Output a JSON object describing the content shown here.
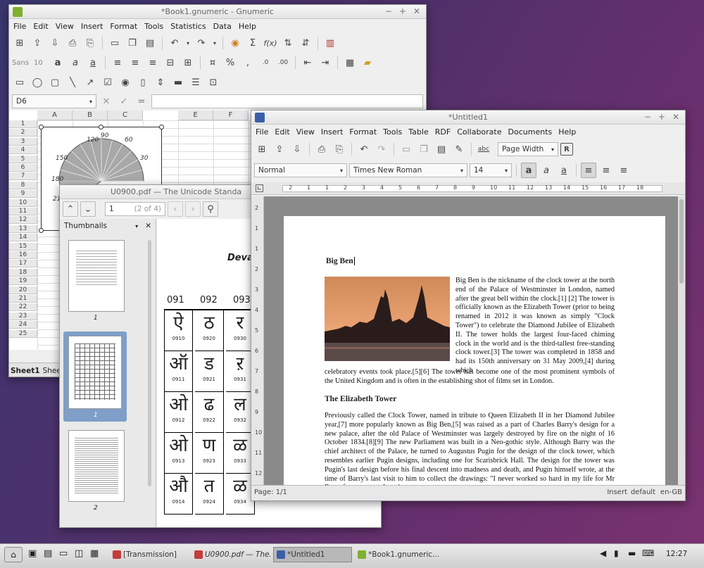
{
  "gnumeric": {
    "title": "*Book1.gnumeric - Gnumeric",
    "menu": [
      "File",
      "Edit",
      "View",
      "Insert",
      "Format",
      "Tools",
      "Statistics",
      "Data",
      "Help"
    ],
    "font_name": "Sans",
    "font_size": "10",
    "cell_ref": "D6",
    "columns": [
      "A",
      "B",
      "C",
      "E",
      "F"
    ],
    "rows": [
      "1",
      "2",
      "3",
      "4",
      "5",
      "6",
      "7",
      "8",
      "9",
      "10",
      "11",
      "12",
      "13",
      "14",
      "15",
      "16",
      "17",
      "18",
      "19",
      "20",
      "21",
      "22",
      "23",
      "24",
      "25"
    ],
    "dial_labels": [
      "120",
      "90",
      "60",
      "150",
      "30",
      "180",
      "210"
    ],
    "sheet_tabs": [
      "Sheet1",
      "Shee"
    ]
  },
  "pdf": {
    "title": "U0900.pdf — The Unicode Standa",
    "page_number": "1",
    "page_of": "(2 of 4)",
    "sidebar_title": "Thumbnails",
    "thumb_labels": [
      "1",
      "1",
      "2"
    ],
    "heading": "Deva",
    "col_headers": [
      "091",
      "092",
      "093"
    ],
    "cells": [
      {
        "glyph": "ऐ",
        "code": "0910"
      },
      {
        "glyph": "ठ",
        "code": "0920"
      },
      {
        "glyph": "र",
        "code": "0930"
      },
      {
        "glyph": "ऑ",
        "code": "0911"
      },
      {
        "glyph": "ड",
        "code": "0921"
      },
      {
        "glyph": "ऱ",
        "code": "0931"
      },
      {
        "glyph": "ओ",
        "code": "0912"
      },
      {
        "glyph": "ढ",
        "code": "0922"
      },
      {
        "glyph": "ल",
        "code": "0932"
      },
      {
        "glyph": "ओ",
        "code": "0913"
      },
      {
        "glyph": "ण",
        "code": "0923"
      },
      {
        "glyph": "ळ",
        "code": "0933"
      },
      {
        "glyph": "औ",
        "code": "0914"
      },
      {
        "glyph": "त",
        "code": "0924"
      },
      {
        "glyph": "ळ",
        "code": "0934"
      }
    ],
    "bottom_codes": [
      "0944",
      "0954",
      "0964",
      "0974"
    ]
  },
  "abiword": {
    "title": "*Untitled1",
    "menu": [
      "File",
      "Edit",
      "View",
      "Insert",
      "Format",
      "Tools",
      "Table",
      "RDF",
      "Collaborate",
      "Documents",
      "Help"
    ],
    "zoom": "Page Width",
    "style": "Normal",
    "font": "Times New Roman",
    "size": "14",
    "ruler_numbers": [
      "2",
      "1",
      "1",
      "2",
      "3",
      "4",
      "5",
      "6",
      "7",
      "8",
      "9",
      "10",
      "11",
      "12",
      "13",
      "14",
      "15",
      "16",
      "17",
      "18"
    ],
    "vruler_numbers": [
      "2",
      "1",
      "1",
      "2",
      "3",
      "4",
      "5",
      "6",
      "7",
      "8",
      "9",
      "10",
      "11",
      "12"
    ],
    "doc_title": "Big Ben",
    "para1_beside": "Big Ben is the nickname of the clock tower at the north end of the Palace of Westminster in London, named after the great bell within the clock.[1] [2] The tower is officially known as the Elizabeth Tower (prior to being renamed in 2012 it was known as simply \"Clock Tower\") to celebrate the Diamond Jubilee of Elizabeth II. The tower holds the largest four-faced chiming clock in the world and is the third-tallest free-standing clock tower.[3] The tower was completed in 1858 and had its 150th anniversary on 31 May 2009,[4] during which",
    "para1_below": "celebratory events took place.[5][6] The tower has become one of the most prominent symbols of the United Kingdom and is often in the establishing shot of films set in London.",
    "heading2": "The Elizabeth Tower",
    "para2": "Previously called the Clock Tower, named in tribute to Queen Elizabeth II in her Diamond Jubilee year,[7] more popularly known as Big Ben,[5] was raised as a part of Charles Barry's design for a new palace, after the old Palace of Westminster was largely destroyed by fire on the night of 16 October 1834.[8][9] The new Parliament was built in a Neo-gothic style. Although Barry was the chief architect of the Palace, he turned to Augustus Pugin for the design of the clock tower, which resembles earlier Pugin designs, including one for Scarisbrick Hall. The design for the tower was Pugin's last design before his final descent into madness and death, and Pugin himself wrote, at the time of Barry's last visit to him to collect the drawings: \"I never worked so hard in my life for Mr Barry for tomorrow I render",
    "status_page": "Page: 1/1",
    "status_insert": "Insert",
    "status_default": "default",
    "status_lang": "en-GB"
  },
  "taskbar": {
    "items": [
      "[Transmission]",
      "U0900.pdf — The...",
      "*Untitled1",
      "*Book1.gnumeric..."
    ],
    "clock": "12:27"
  },
  "colors": {
    "desktop": "#4a3270",
    "selection": "#7f9fc8",
    "gnumeric_icon": "#7fb030",
    "abiword_icon": "#3a5fa8",
    "pdf_icon": "#c43c3c"
  }
}
